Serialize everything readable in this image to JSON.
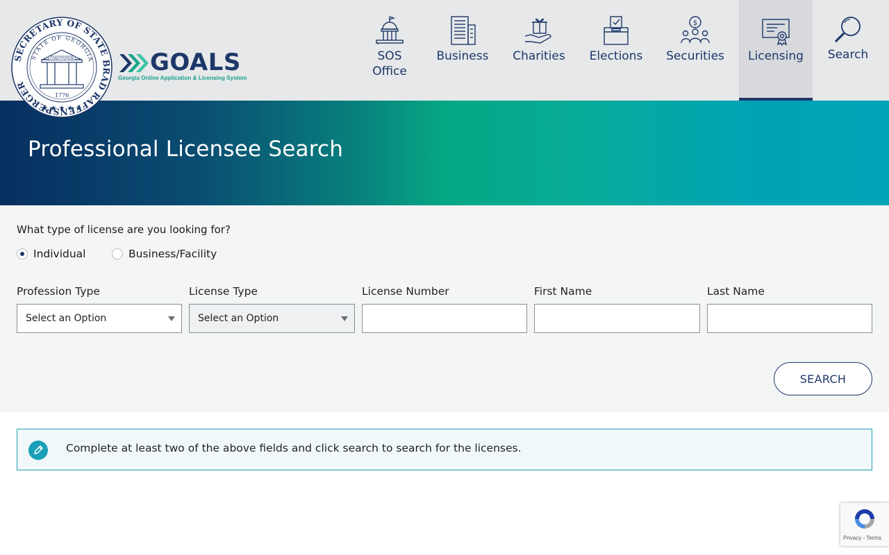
{
  "header": {
    "seal_text": "SECRETARY OF STATE BRAD RAFFENSPERGER",
    "seal_inner": "STATE OF GEORGIA",
    "seal_banner": "CONSTITUTION",
    "seal_year": "1776",
    "logo_word": "GOALS",
    "logo_tagline": "Georgia Online Application & Licensing System"
  },
  "nav": {
    "items": [
      {
        "label": "SOS Office",
        "icon": "capitol-icon"
      },
      {
        "label": "Business",
        "icon": "building-icon"
      },
      {
        "label": "Charities",
        "icon": "gift-hand-icon"
      },
      {
        "label": "Elections",
        "icon": "ballot-box-icon"
      },
      {
        "label": "Securities",
        "icon": "investor-icon"
      },
      {
        "label": "Licensing",
        "icon": "certificate-icon",
        "active": true
      },
      {
        "label": "Search",
        "icon": "magnifier-icon"
      }
    ]
  },
  "hero": {
    "title": "Professional Licensee Search"
  },
  "form": {
    "question": "What type of license are you looking for?",
    "radios": [
      {
        "label": "Individual",
        "checked": true
      },
      {
        "label": "Business/Facility",
        "checked": false
      }
    ],
    "fields": {
      "profession_type": {
        "label": "Profession Type",
        "value": "Select an Option"
      },
      "license_type": {
        "label": "License Type",
        "value": "Select an Option"
      },
      "license_number": {
        "label": "License Number",
        "value": ""
      },
      "first_name": {
        "label": "First Name",
        "value": ""
      },
      "last_name": {
        "label": "Last Name",
        "value": ""
      }
    },
    "search_label": "SEARCH"
  },
  "info": {
    "text": "Complete at least two of the above fields and click search to search for the licenses."
  },
  "recaptcha": {
    "text": "Privacy - Terms"
  },
  "colors": {
    "brand_navy": "#1d3768",
    "teal": "#1aa0b8",
    "green": "#05a784"
  }
}
